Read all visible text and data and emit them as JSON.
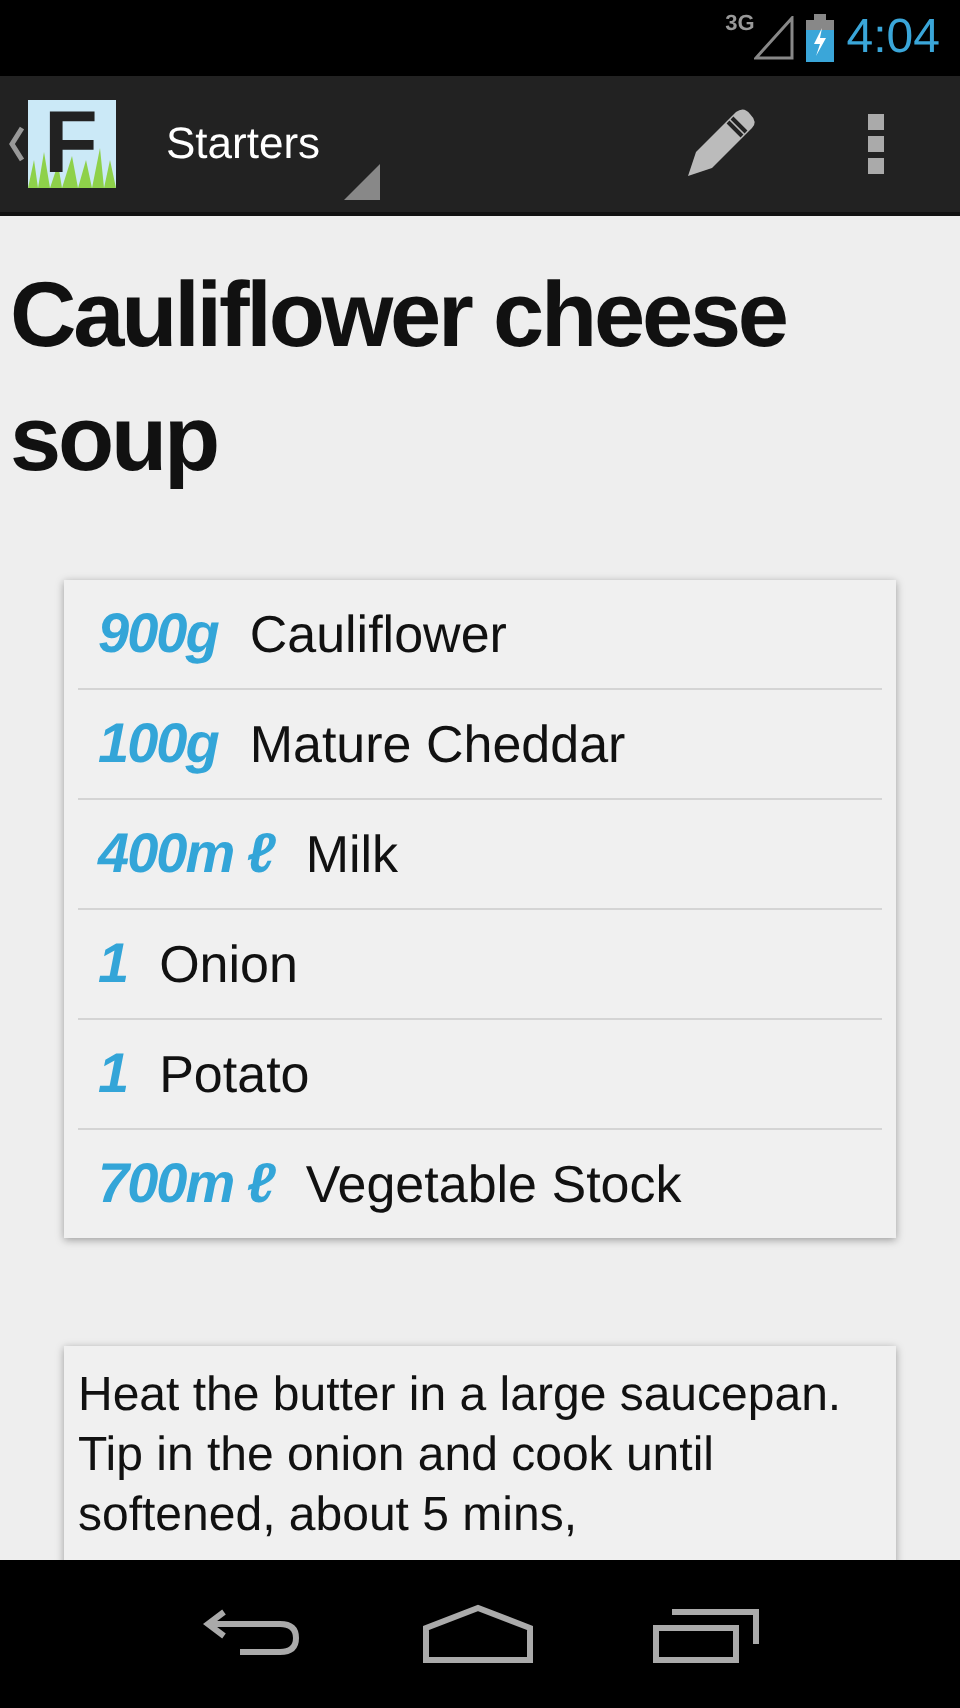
{
  "status_bar": {
    "network": "3G",
    "time": "4:04"
  },
  "action_bar": {
    "logo_letter": "F",
    "category": "Starters"
  },
  "recipe": {
    "title": "Cauliflower cheese soup",
    "ingredients": [
      {
        "quantity": "900g",
        "name": "Cauliflower"
      },
      {
        "quantity": "100g",
        "name": "Mature Cheddar"
      },
      {
        "quantity": "400m ℓ",
        "name": "Milk"
      },
      {
        "quantity": "1",
        "name": "Onion"
      },
      {
        "quantity": "1",
        "name": "Potato"
      },
      {
        "quantity": "700m ℓ",
        "name": "Vegetable Stock"
      }
    ],
    "method": "Heat the butter in a large saucepan. Tip in the onion and cook until softened, about 5 mins,"
  }
}
